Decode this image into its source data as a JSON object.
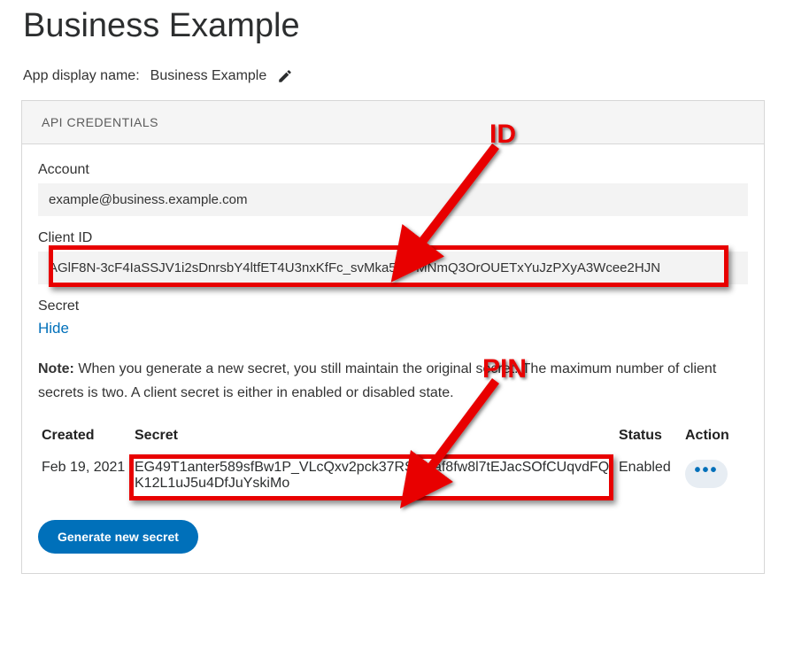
{
  "page": {
    "title": "Business Example",
    "appDisplayLabel": "App display name:",
    "appDisplayName": "Business Example"
  },
  "card": {
    "header": "API CREDENTIALS",
    "accountLabel": "Account",
    "accountValue": "example@business.example.com",
    "clientIdLabel": "Client ID",
    "clientIdValue": "AGlF8N-3cF4IaSSJV1i2sDnrsbY4ltfET4U3nxKfFc_svMka5DOMNmQ3OrOUETxYuJzPXyA3Wcee2HJN",
    "secretLabel": "Secret",
    "hideLink": "Hide",
    "noteBold": "Note:",
    "noteText": " When you generate a new secret, you still maintain the original secret. The maximum number of client secrets is two. A client secret is either in enabled or disabled state.",
    "generateBtn": "Generate new secret"
  },
  "table": {
    "headers": {
      "created": "Created",
      "secret": "Secret",
      "status": "Status",
      "action": "Action"
    },
    "rows": [
      {
        "created": "Feb 19, 2021",
        "secret": "EG49T1anter589sfBw1P_VLcQxv2pck37RSDXaf8fw8l7tEJacSOfCUqvdFQK12L1uJ5u4DfJuYskiMo",
        "status": "Enabled"
      }
    ]
  },
  "annotations": {
    "idLabel": "ID",
    "pinLabel": "PIN"
  }
}
